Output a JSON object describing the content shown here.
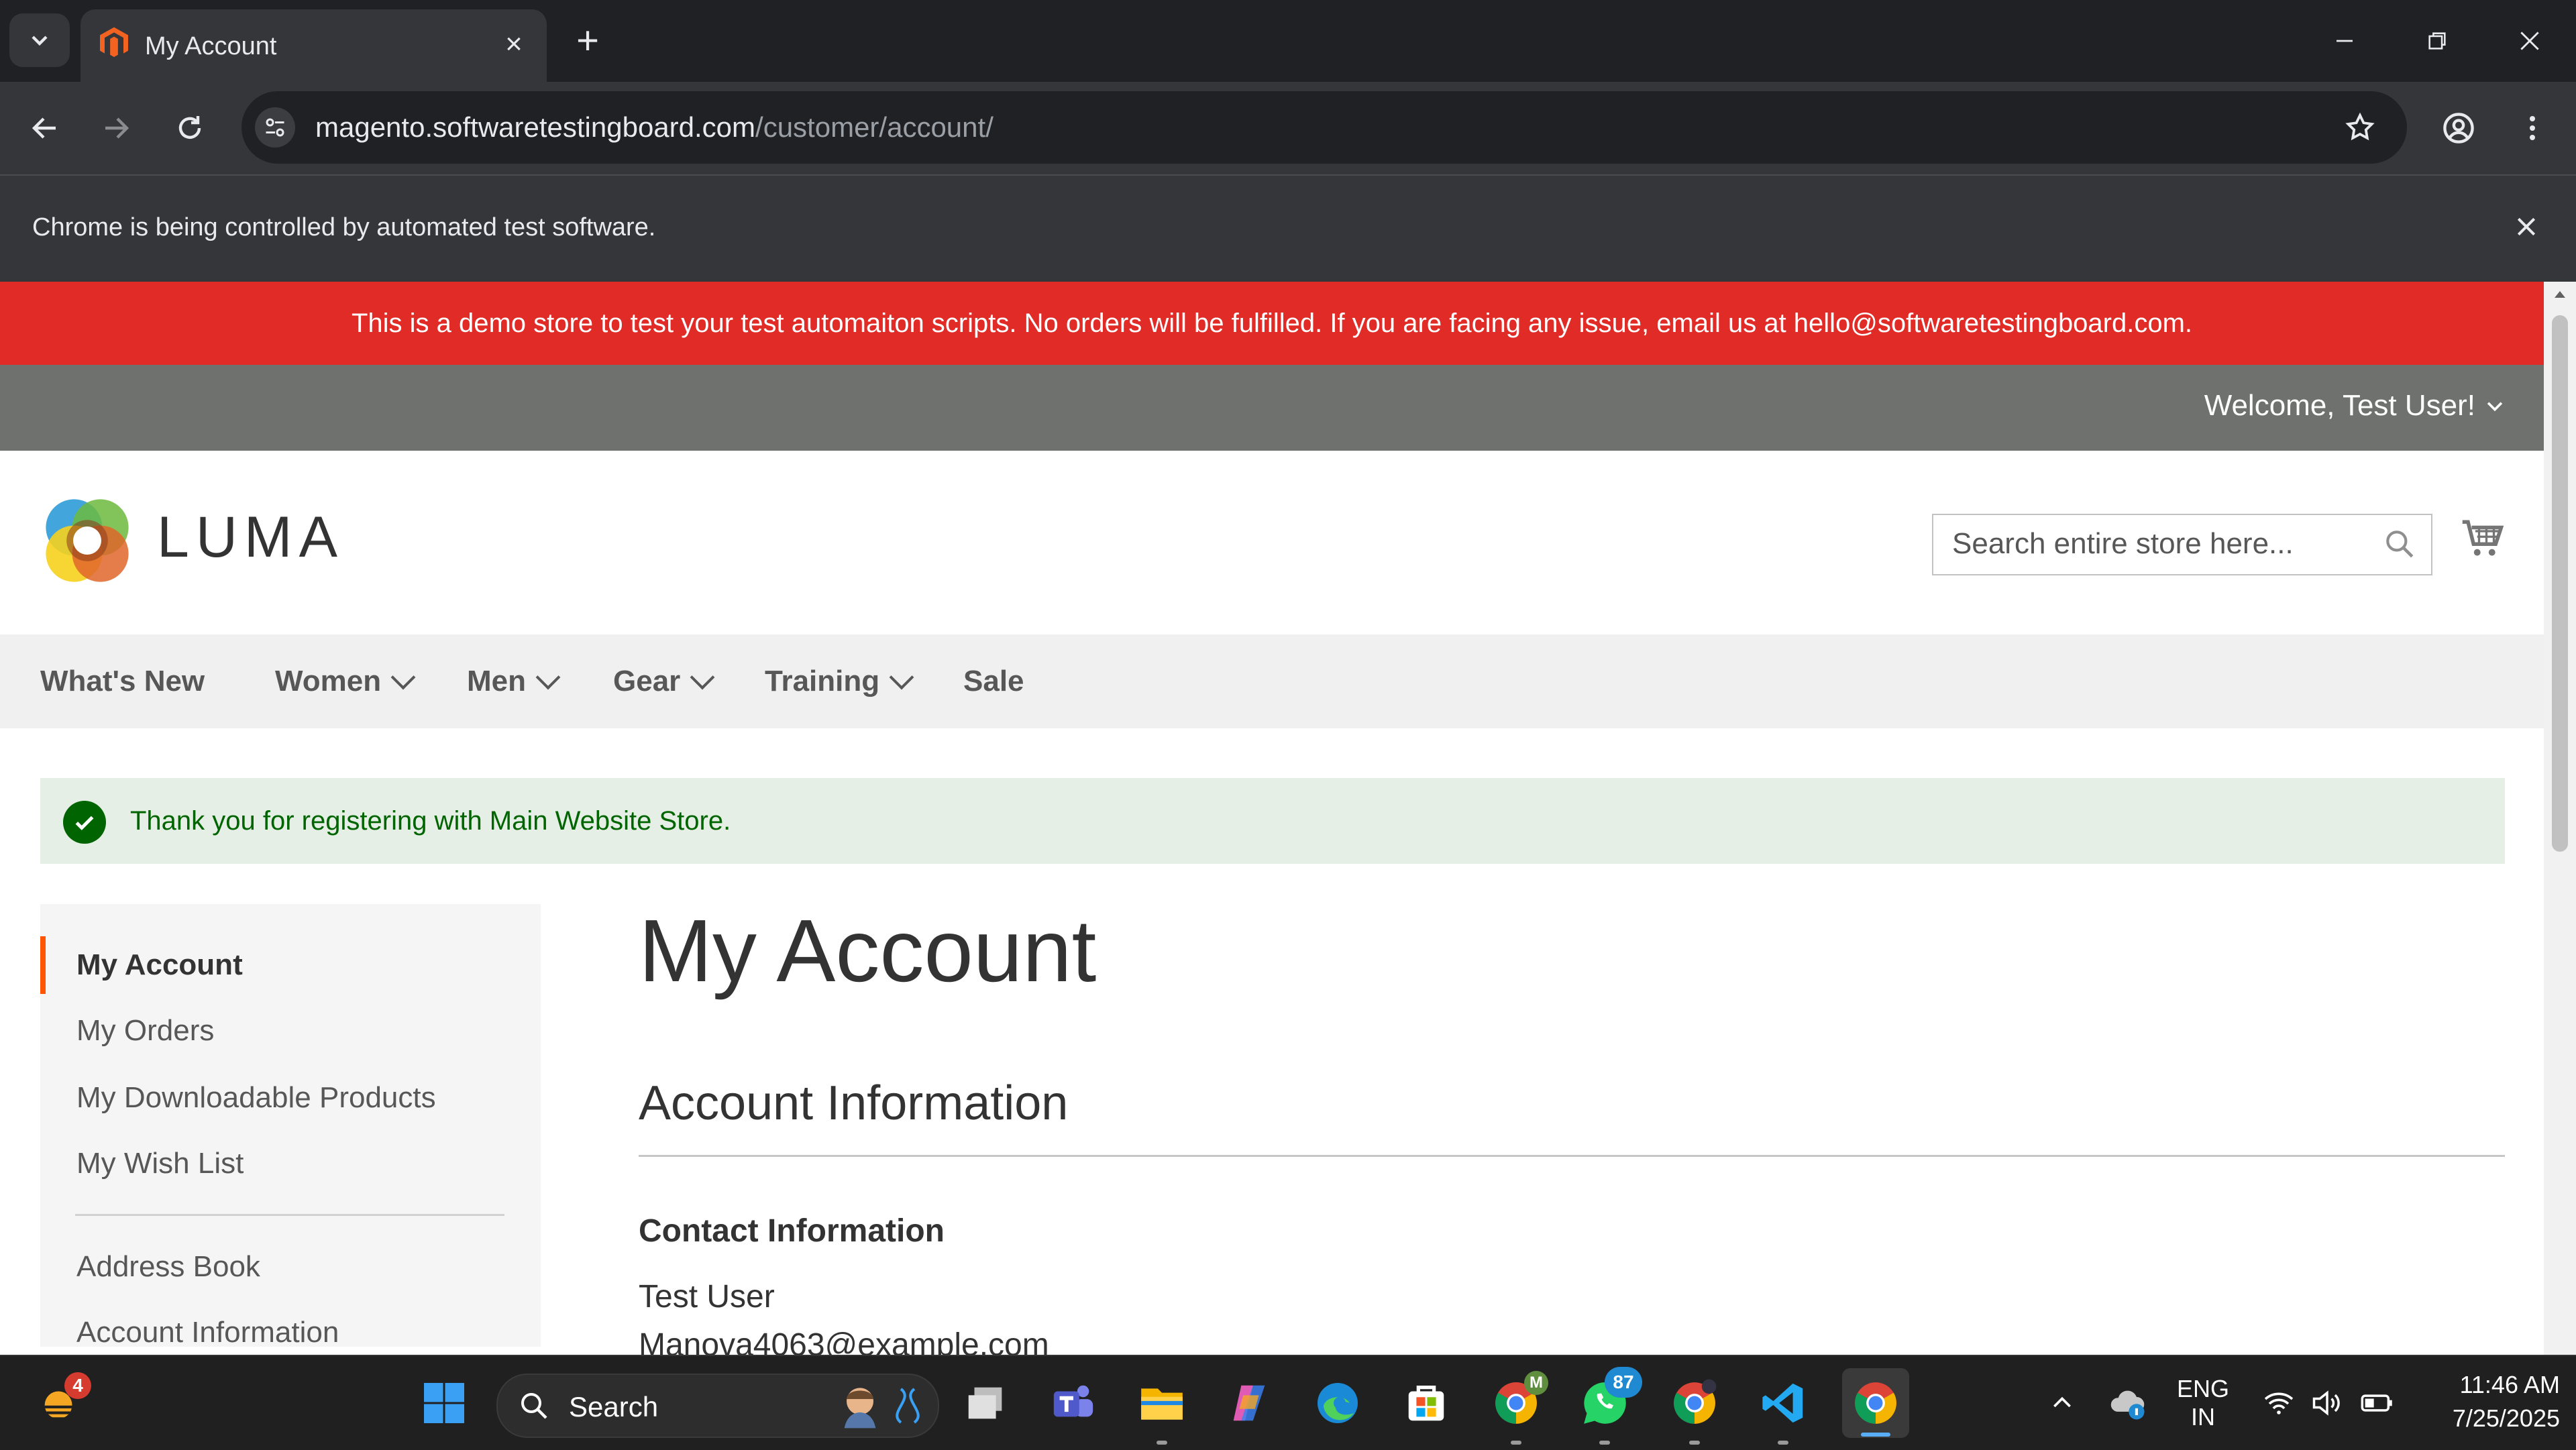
{
  "browser": {
    "tab_title": "My Account",
    "url_host": "magento.softwaretestingboard.com",
    "url_path": "/customer/account/",
    "automation_notice": "Chrome is being controlled by automated test software."
  },
  "page": {
    "demo_banner": "This is a demo store to test your test automaiton scripts. No orders will be fulfilled. If you are facing any issue, email us at hello@softwaretestingboard.com.",
    "welcome": "Welcome, Test User!",
    "logo_text": "LUMA",
    "search_placeholder": "Search entire store here...",
    "nav": [
      {
        "label": "What's New",
        "dropdown": false
      },
      {
        "label": "Women",
        "dropdown": true
      },
      {
        "label": "Men",
        "dropdown": true
      },
      {
        "label": "Gear",
        "dropdown": true
      },
      {
        "label": "Training",
        "dropdown": true
      },
      {
        "label": "Sale",
        "dropdown": false
      }
    ],
    "success_message": "Thank you for registering with Main Website Store.",
    "sidebar": {
      "current": "My Account",
      "items": [
        "My Orders",
        "My Downloadable Products",
        "My Wish List"
      ],
      "items2": [
        "Address Book",
        "Account Information"
      ]
    },
    "title": "My Account",
    "section_title": "Account Information",
    "contact_title": "Contact Information",
    "contact_name": "Test User",
    "contact_email": "Manova4063@example.com"
  },
  "taskbar": {
    "search_label": "Search",
    "weather_badge": "4",
    "whatsapp_badge": "87",
    "language": "ENG",
    "region": "IN",
    "time": "11:46 AM",
    "date": "7/25/2025"
  },
  "colors": {
    "accent": "#ff5501",
    "banner": "#e02b27",
    "success_green": "#006400"
  }
}
